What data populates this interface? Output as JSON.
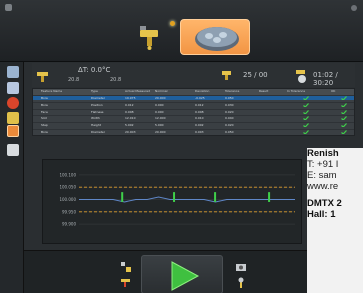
{
  "header": {
    "modes": [
      {
        "name": "probe-mode",
        "active": false
      },
      {
        "name": "part-setup-mode",
        "active": true
      }
    ],
    "accent": "#f29544"
  },
  "status": {
    "delta_t": "ΔT: 0.0°C",
    "t1": "20.8",
    "t2": "20.8",
    "count": "25 / 00",
    "time": "01:02 / 30:20"
  },
  "table": {
    "headers": [
      "Feature Name",
      "Type",
      "Actual Measured",
      "Nominal",
      "Deviation",
      "Tolerance",
      "Result",
      "In Tolerance",
      "OK"
    ],
    "rows": [
      {
        "name": "Bore",
        "type": "Diameter",
        "actual": "19.975",
        "nominal": "20.000",
        "dev": "-0.025",
        "tol": "0.050",
        "ok": true,
        "selected": true
      },
      {
        "name": "Bore",
        "type": "Position",
        "actual": "0.012",
        "nominal": "0.000",
        "dev": "0.012",
        "tol": "0.030",
        "ok": true,
        "selected": false
      },
      {
        "name": "Face",
        "type": "Flatness",
        "actual": "0.008",
        "nominal": "0.000",
        "dev": "0.008",
        "tol": "0.020",
        "ok": true,
        "selected": false
      },
      {
        "name": "Slot",
        "type": "Width",
        "actual": "12.010",
        "nominal": "12.000",
        "dev": "0.010",
        "tol": "0.040",
        "ok": true,
        "selected": false
      },
      {
        "name": "Step",
        "type": "Height",
        "actual": "5.002",
        "nominal": "5.000",
        "dev": "0.002",
        "tol": "0.020",
        "ok": true,
        "selected": false
      },
      {
        "name": "Bore",
        "type": "Diameter",
        "actual": "20.003",
        "nominal": "20.000",
        "dev": "0.003",
        "tol": "0.050",
        "ok": true,
        "selected": false
      }
    ]
  },
  "chart_data": {
    "type": "line",
    "ylabel": "",
    "xlabel": "",
    "yticks": [
      "100.100",
      "100.050",
      "100.000",
      "99.950",
      "99.900"
    ],
    "ylim": [
      99.88,
      100.12
    ],
    "series": [
      {
        "values": [
          100.0,
          100.0,
          100.0,
          100.0,
          99.99,
          100.0,
          100.0,
          100.01,
          100.0,
          100.0,
          100.0,
          100.0,
          99.99,
          100.0,
          100.0,
          100.0,
          100.0,
          100.0,
          100.0,
          100.0
        ],
        "color": "#5f87c8"
      }
    ],
    "limits": {
      "upper": 100.05,
      "lower": 99.95
    },
    "spikes_x": [
      0.2,
      0.44,
      0.63,
      0.88
    ]
  },
  "infobox": {
    "company": "Renish",
    "phone": "T: +91 I",
    "email": "E: sam",
    "web": "www.re",
    "product": "DMTX 2",
    "hall": "Hall: 1"
  }
}
